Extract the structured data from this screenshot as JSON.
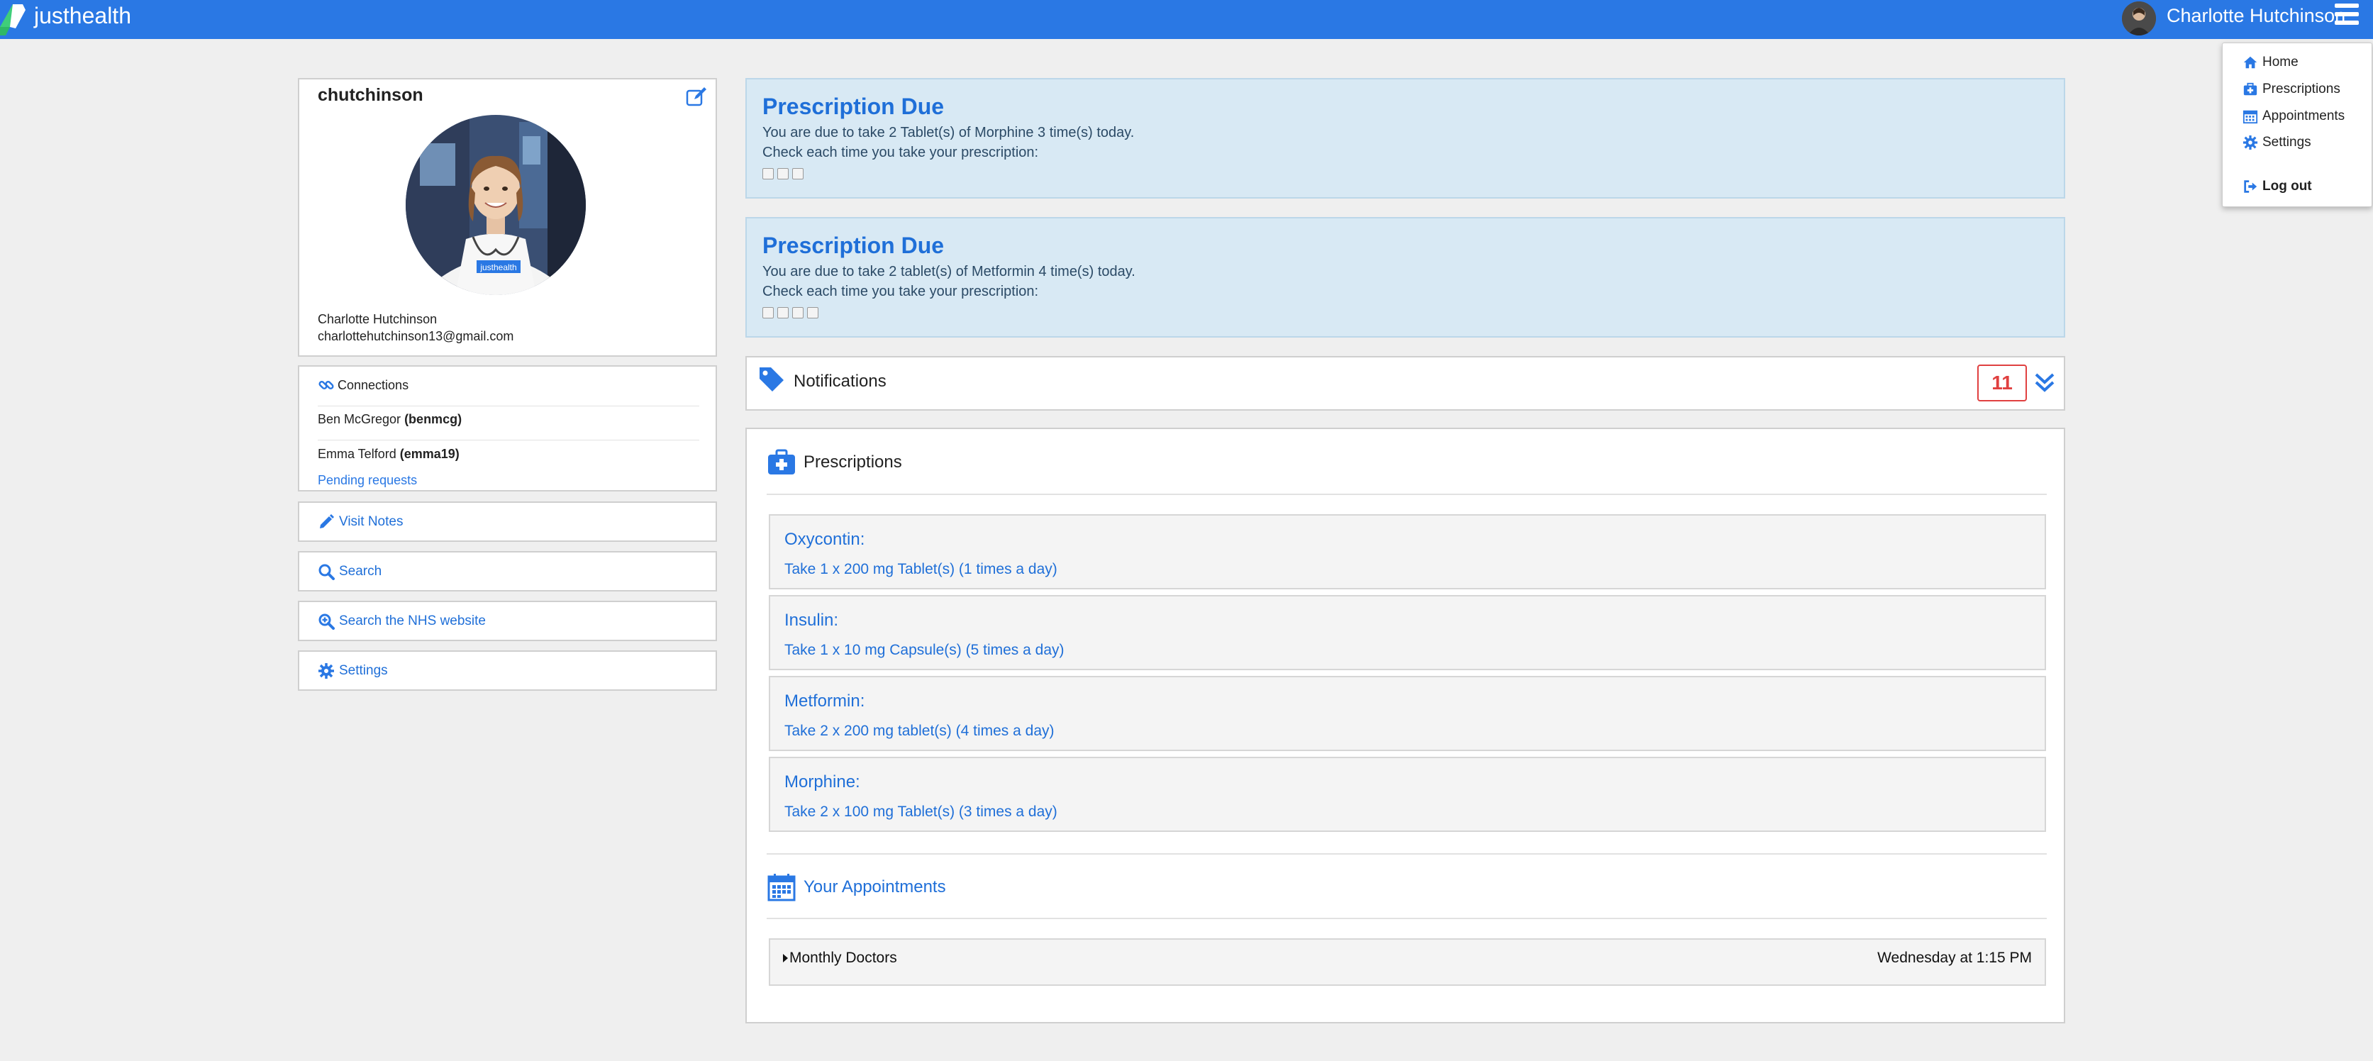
{
  "app": {
    "brand": "justhealth"
  },
  "header": {
    "user_name": "Charlotte Hutchinson"
  },
  "menu": {
    "items": [
      {
        "label": "Home",
        "icon": "home-icon"
      },
      {
        "label": "Prescriptions",
        "icon": "medkit-icon"
      },
      {
        "label": "Appointments",
        "icon": "calendar-icon"
      },
      {
        "label": "Settings",
        "icon": "gear-icon"
      }
    ],
    "logout": "Log out"
  },
  "profile": {
    "username": "chutchinson",
    "full_name": "Charlotte Hutchinson",
    "email": "charlottehutchinson13@gmail.com",
    "shirt_text": "justhealth"
  },
  "connections": {
    "title": "Connections",
    "people": [
      {
        "name": "Ben McGregor",
        "handle": "(benmcg)"
      },
      {
        "name": "Emma Telford",
        "handle": "(emma19)"
      }
    ],
    "pending": "Pending requests"
  },
  "actions": {
    "visit_notes": "Visit Notes",
    "search": "Search",
    "search_nhs": "Search the NHS website",
    "settings": "Settings"
  },
  "alerts": [
    {
      "title": "Prescription Due",
      "line1": "You are due to take 2 Tablet(s) of Morphine 3 time(s) today.",
      "line2": "Check each time you take your prescription:",
      "checkbox_count": 3
    },
    {
      "title": "Prescription Due",
      "line1": "You are due to take 2 tablet(s) of Metformin 4 time(s) today.",
      "line2": "Check each time you take your prescription:",
      "checkbox_count": 4
    }
  ],
  "notifications": {
    "label": "Notifications",
    "count": "11"
  },
  "prescriptions": {
    "title": "Prescriptions",
    "items": [
      {
        "name": "Oxycontin:",
        "dose": "Take 1 x 200 mg Tablet(s) (1 times a day)"
      },
      {
        "name": "Insulin:",
        "dose": "Take 1 x 10 mg Capsule(s) (5 times a day)"
      },
      {
        "name": "Metformin:",
        "dose": "Take 2 x 200 mg tablet(s) (4 times a day)"
      },
      {
        "name": "Morphine:",
        "dose": "Take 2 x 100 mg Tablet(s) (3 times a day)"
      }
    ]
  },
  "appointments": {
    "title": "Your Appointments",
    "items": [
      {
        "title": "Monthly Doctors",
        "time": "Wednesday at 1:15 PM"
      }
    ]
  },
  "colors": {
    "accent": "#2a78e4",
    "link": "#1f6fd8",
    "badge": "#e04040",
    "alert_bg": "#d8e9f4"
  }
}
